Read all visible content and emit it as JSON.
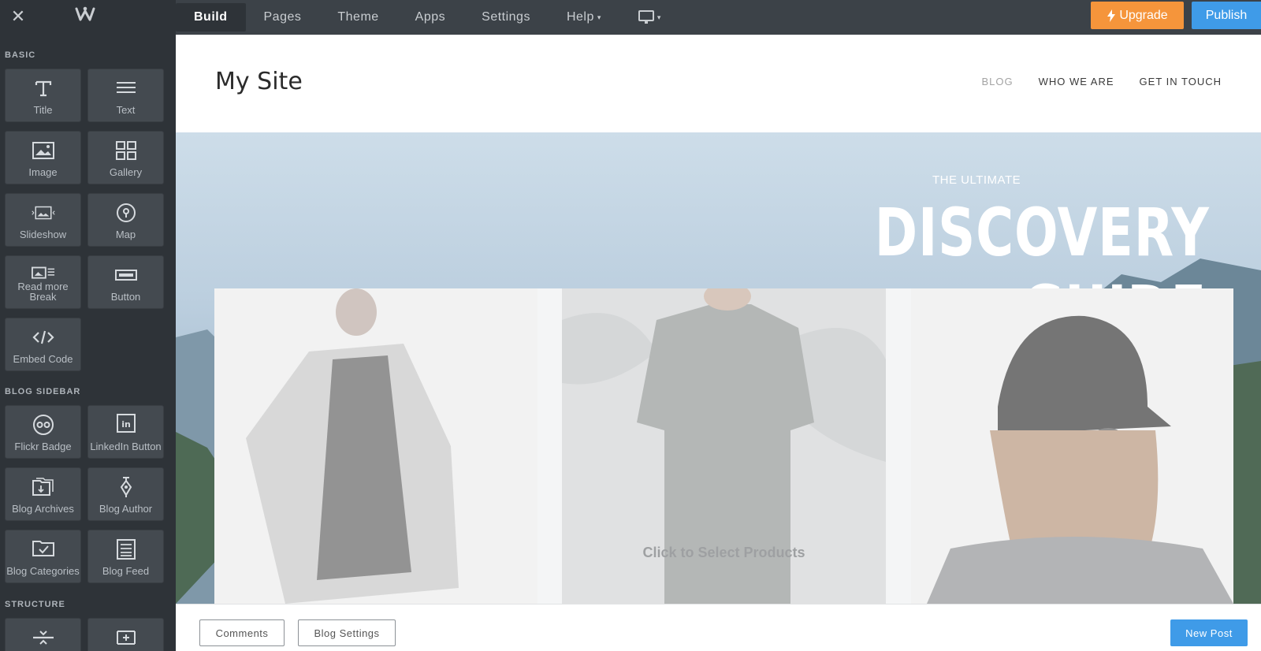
{
  "topbar": {
    "close_icon": "close-icon",
    "logo_icon": "weebly-logo",
    "nav": [
      {
        "label": "Build",
        "active": true
      },
      {
        "label": "Pages"
      },
      {
        "label": "Theme"
      },
      {
        "label": "Apps"
      },
      {
        "label": "Settings"
      },
      {
        "label": "Help"
      }
    ],
    "device_icon": "monitor-icon",
    "upgrade_label": "Upgrade",
    "publish_label": "Publish",
    "colors": {
      "upgrade": "#f5953b",
      "publish": "#3f9be8"
    }
  },
  "sidebar": {
    "sections": [
      {
        "title": "BASIC",
        "items": [
          {
            "label": "Title",
            "icon": "title-icon"
          },
          {
            "label": "Text",
            "icon": "text-lines-icon"
          },
          {
            "label": "Image",
            "icon": "image-icon"
          },
          {
            "label": "Gallery",
            "icon": "gallery-grid-icon"
          },
          {
            "label": "Slideshow",
            "icon": "slideshow-icon"
          },
          {
            "label": "Map",
            "icon": "map-pin-icon"
          },
          {
            "label": "Read more Break",
            "icon": "read-more-icon"
          },
          {
            "label": "Button",
            "icon": "button-icon"
          },
          {
            "label": "Embed Code",
            "icon": "code-icon"
          }
        ]
      },
      {
        "title": "BLOG SIDEBAR",
        "items": [
          {
            "label": "Flickr Badge",
            "icon": "flickr-icon"
          },
          {
            "label": "LinkedIn Button",
            "icon": "linkedin-icon"
          },
          {
            "label": "Blog Archives",
            "icon": "archive-icon"
          },
          {
            "label": "Blog Author",
            "icon": "pen-nib-icon"
          },
          {
            "label": "Blog Categories",
            "icon": "folder-check-icon"
          },
          {
            "label": "Blog Feed",
            "icon": "feed-icon"
          }
        ]
      },
      {
        "title": "STRUCTURE",
        "items": [
          {
            "label": "",
            "icon": "divider-icon"
          },
          {
            "label": "",
            "icon": "spacer-icon"
          }
        ]
      }
    ]
  },
  "site": {
    "title": "My Site",
    "nav": [
      "BLOG",
      "WHO WE ARE",
      "GET IN TOUCH"
    ],
    "hero_kicker": "THE ULTIMATE",
    "hero_title": "DISCOVERY GUIDE",
    "products_cta": "Click to Select Products"
  },
  "bottombar": {
    "comments_label": "Comments",
    "blog_settings_label": "Blog Settings",
    "new_post_label": "New Post"
  }
}
